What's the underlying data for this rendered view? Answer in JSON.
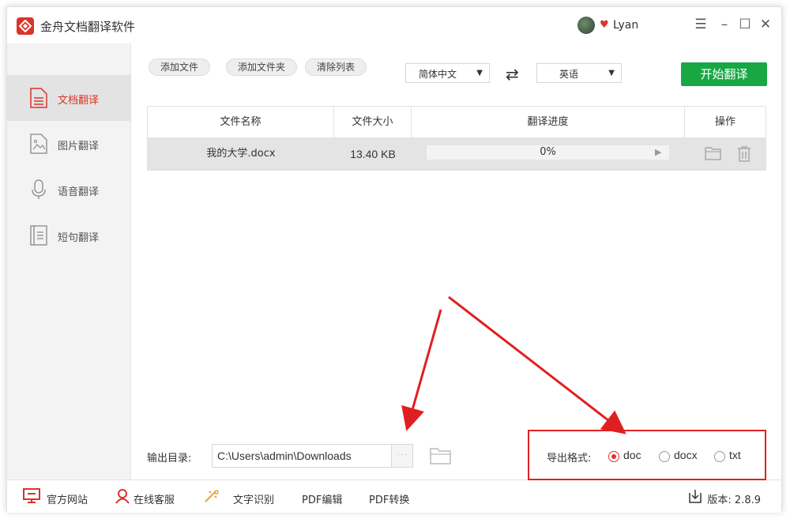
{
  "app": {
    "title": "金舟文档翻译软件",
    "username": "Lyan"
  },
  "sidebar": {
    "items": [
      {
        "label": "文档翻译",
        "icon": "document-icon",
        "active": true
      },
      {
        "label": "图片翻译",
        "icon": "image-icon",
        "active": false
      },
      {
        "label": "语音翻译",
        "icon": "microphone-icon",
        "active": false
      },
      {
        "label": "短句翻译",
        "icon": "text-icon",
        "active": false
      }
    ]
  },
  "toolbar": {
    "add_file": "添加文件",
    "add_folder": "添加文件夹",
    "clear_list": "清除列表",
    "source_lang": "简体中文",
    "target_lang": "英语",
    "start": "开始翻译"
  },
  "table": {
    "headers": [
      "文件名称",
      "文件大小",
      "翻译进度",
      "操作"
    ],
    "rows": [
      {
        "name": "我的大学.docx",
        "size": "13.40 KB",
        "progress": "0%"
      }
    ]
  },
  "output": {
    "label": "输出目录:",
    "path": "C:\\Users\\admin\\Downloads",
    "dots": "···"
  },
  "export": {
    "label": "导出格式:",
    "options": [
      "doc",
      "docx",
      "txt"
    ],
    "selected": "doc"
  },
  "footer": {
    "website": "官方网站",
    "support": "在线客服",
    "ocr": "文字识别",
    "pdf_edit": "PDF编辑",
    "pdf_convert": "PDF转换",
    "version": "版本: 2.8.9"
  },
  "colors": {
    "accent": "#d9342b",
    "start": "#17a844",
    "annotation": "#e02020"
  }
}
